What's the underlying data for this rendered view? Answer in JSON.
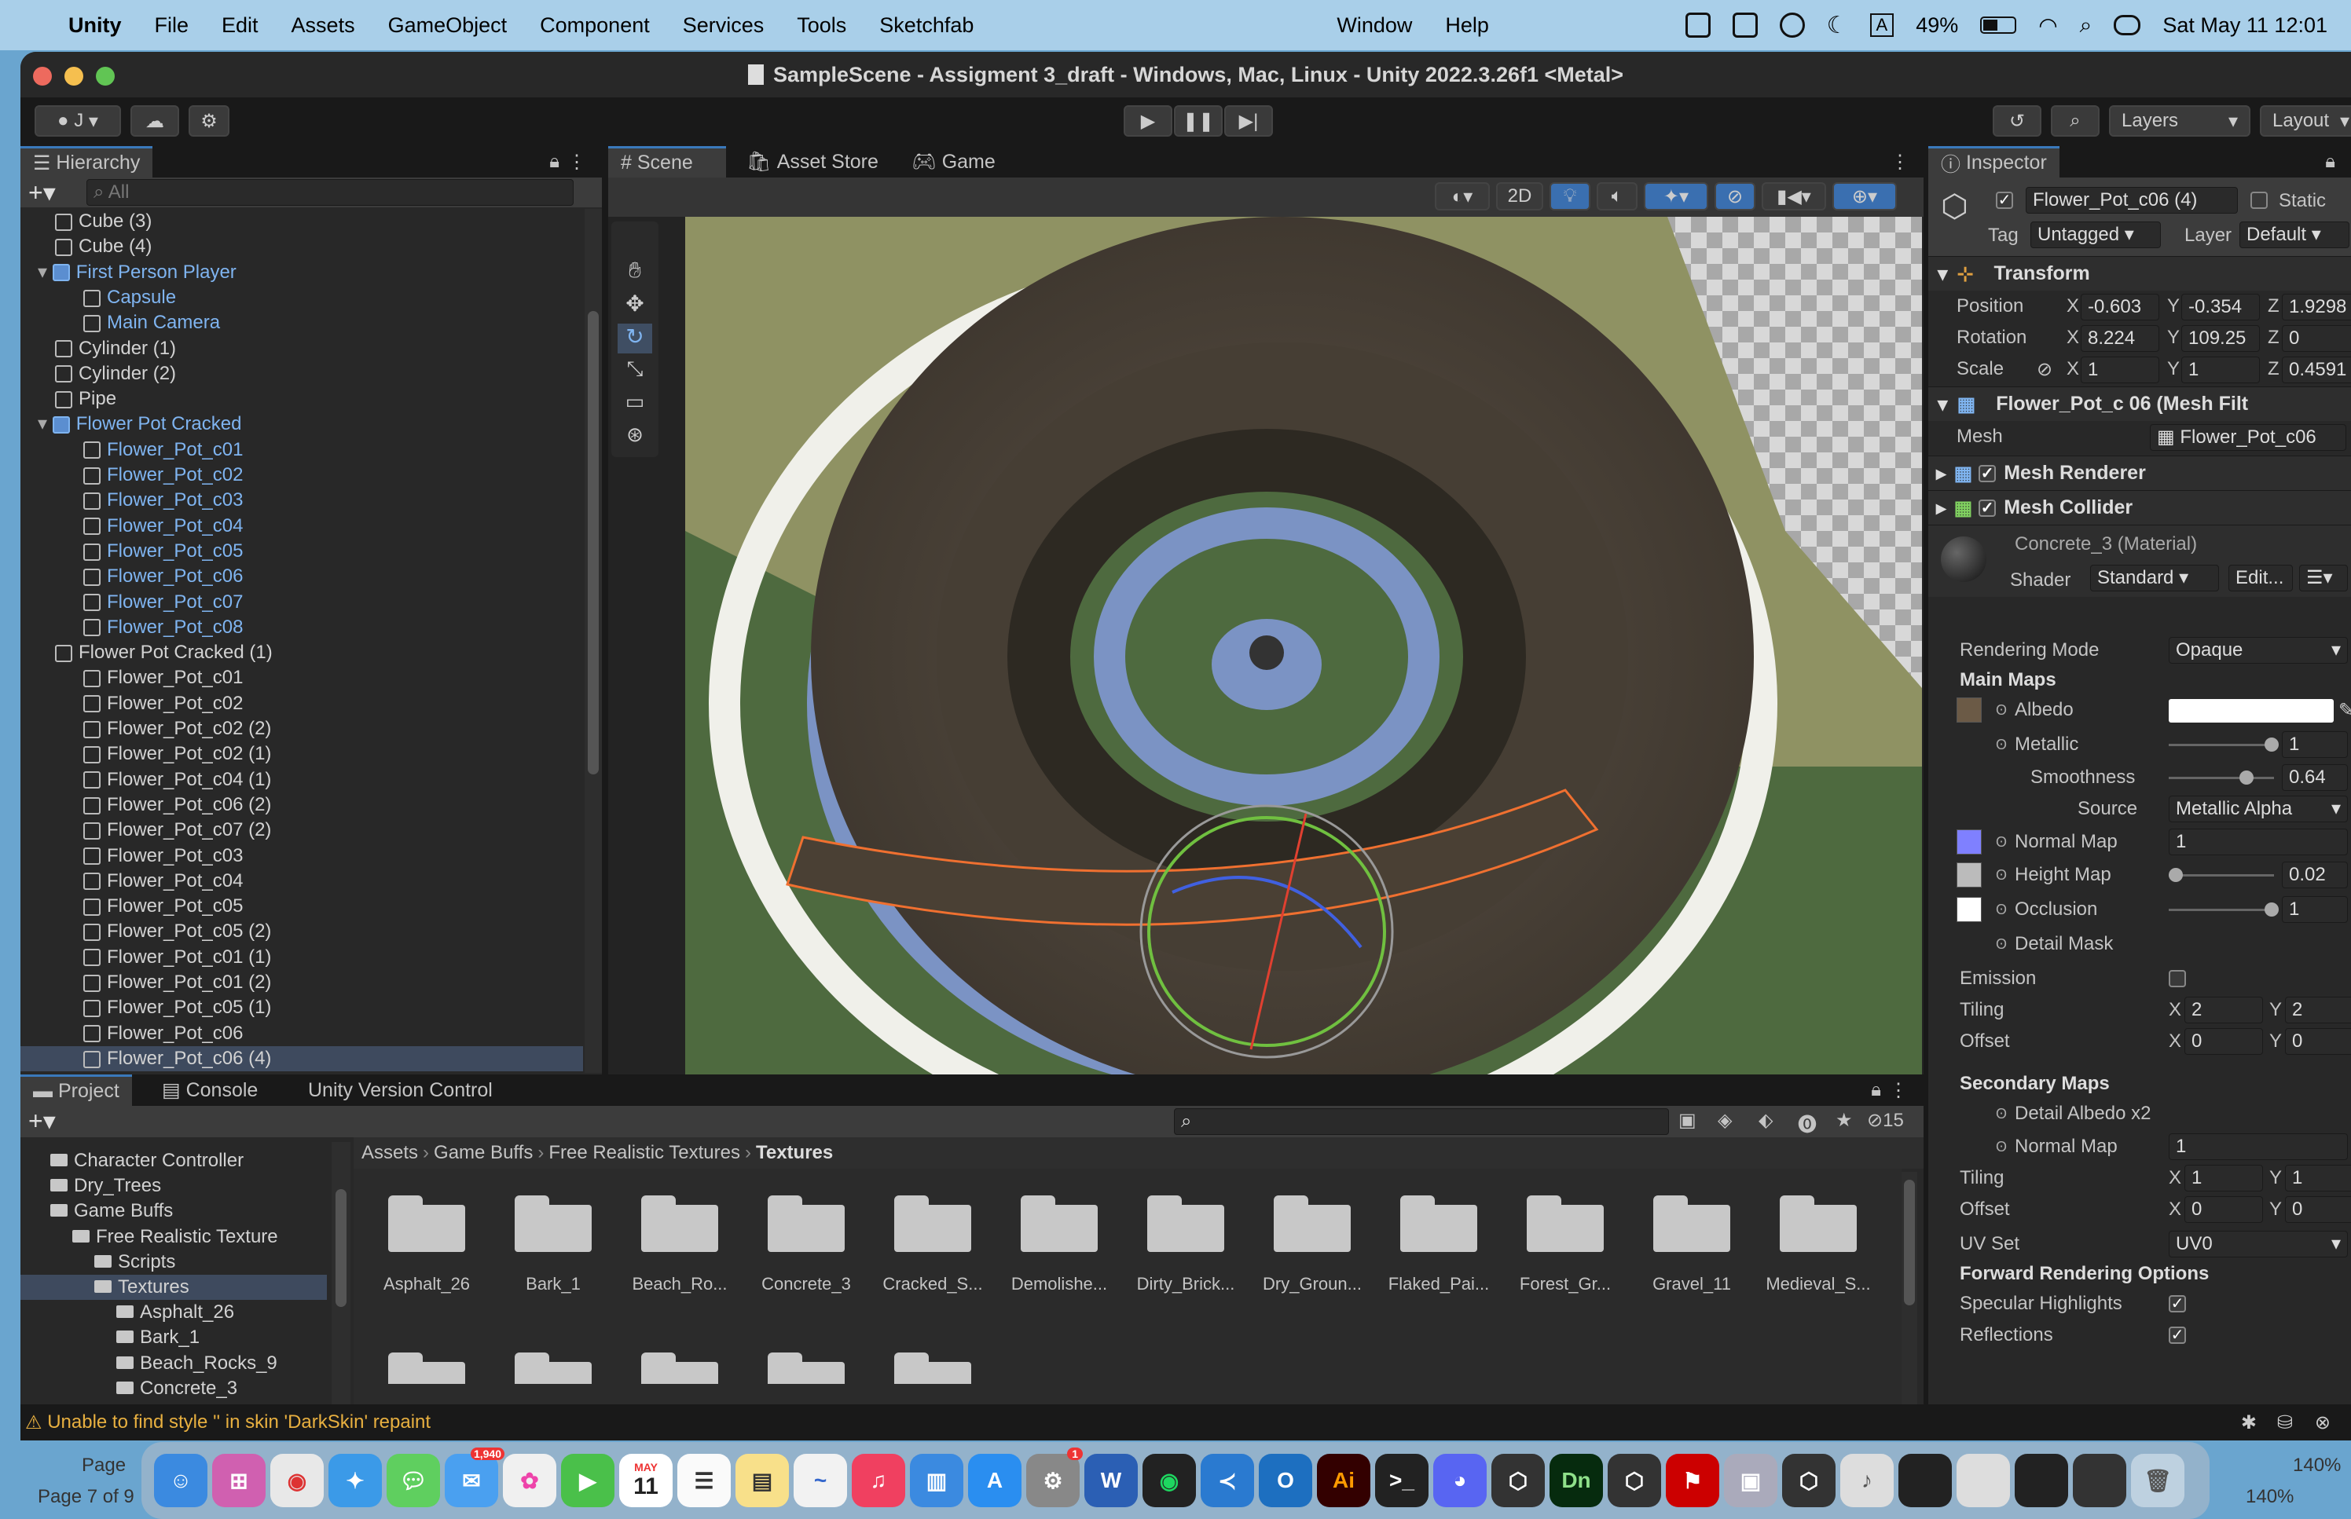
{
  "menubar": {
    "app": "Unity",
    "items": [
      "File",
      "Edit",
      "Assets",
      "GameObject",
      "Component",
      "Services",
      "Tools",
      "Sketchfab",
      "Window",
      "Help"
    ],
    "battery": "49%",
    "input": "A",
    "datetime": "Sat May 11  12:01"
  },
  "window": {
    "title": "SampleScene - Assigment 3_draft - Windows, Mac, Linux - Unity 2022.3.26f1 <Metal>"
  },
  "toolbar": {
    "account": "J",
    "layers": "Layers",
    "layout": "Layout"
  },
  "hierarchy": {
    "tab": "Hierarchy",
    "search_placeholder": "All",
    "items": [
      {
        "label": "Cube (3)",
        "indent": 1,
        "blue": false
      },
      {
        "label": "Cube (4)",
        "indent": 1,
        "blue": false
      },
      {
        "label": "First Person Player",
        "indent": 1,
        "blue": true,
        "prefab": true
      },
      {
        "label": "Capsule",
        "indent": 2,
        "blue": true
      },
      {
        "label": "Main Camera",
        "indent": 2,
        "blue": true
      },
      {
        "label": "Cylinder (1)",
        "indent": 1,
        "blue": false
      },
      {
        "label": "Cylinder (2)",
        "indent": 1,
        "blue": false
      },
      {
        "label": "Pipe",
        "indent": 1,
        "blue": false
      },
      {
        "label": "Flower Pot Cracked",
        "indent": 1,
        "blue": true,
        "prefab": true
      },
      {
        "label": "Flower_Pot_c01",
        "indent": 2,
        "blue": true
      },
      {
        "label": "Flower_Pot_c02",
        "indent": 2,
        "blue": true
      },
      {
        "label": "Flower_Pot_c03",
        "indent": 2,
        "blue": true
      },
      {
        "label": "Flower_Pot_c04",
        "indent": 2,
        "blue": true
      },
      {
        "label": "Flower_Pot_c05",
        "indent": 2,
        "blue": true
      },
      {
        "label": "Flower_Pot_c06",
        "indent": 2,
        "blue": true
      },
      {
        "label": "Flower_Pot_c07",
        "indent": 2,
        "blue": true
      },
      {
        "label": "Flower_Pot_c08",
        "indent": 2,
        "blue": true
      },
      {
        "label": "Flower Pot Cracked (1)",
        "indent": 1,
        "blue": false
      },
      {
        "label": "Flower_Pot_c01",
        "indent": 2,
        "blue": false
      },
      {
        "label": "Flower_Pot_c02",
        "indent": 2,
        "blue": false
      },
      {
        "label": "Flower_Pot_c02 (2)",
        "indent": 2,
        "blue": false
      },
      {
        "label": "Flower_Pot_c02 (1)",
        "indent": 2,
        "blue": false
      },
      {
        "label": "Flower_Pot_c04 (1)",
        "indent": 2,
        "blue": false
      },
      {
        "label": "Flower_Pot_c06 (2)",
        "indent": 2,
        "blue": false
      },
      {
        "label": "Flower_Pot_c07 (2)",
        "indent": 2,
        "blue": false
      },
      {
        "label": "Flower_Pot_c03",
        "indent": 2,
        "blue": false
      },
      {
        "label": "Flower_Pot_c04",
        "indent": 2,
        "blue": false
      },
      {
        "label": "Flower_Pot_c05",
        "indent": 2,
        "blue": false
      },
      {
        "label": "Flower_Pot_c05 (2)",
        "indent": 2,
        "blue": false
      },
      {
        "label": "Flower_Pot_c01 (1)",
        "indent": 2,
        "blue": false
      },
      {
        "label": "Flower_Pot_c01 (2)",
        "indent": 2,
        "blue": false
      },
      {
        "label": "Flower_Pot_c05 (1)",
        "indent": 2,
        "blue": false
      },
      {
        "label": "Flower_Pot_c06",
        "indent": 2,
        "blue": false
      },
      {
        "label": "Flower_Pot_c06 (4)",
        "indent": 2,
        "blue": false,
        "selected": true
      }
    ]
  },
  "scene": {
    "tabs": [
      "Scene",
      "Asset Store",
      "Game"
    ],
    "mode_2d": "2D"
  },
  "project": {
    "tabs": [
      "Project",
      "Console",
      "Unity Version Control"
    ],
    "hidden_count": "15",
    "tree": [
      {
        "label": "Character Controller",
        "indent": 1
      },
      {
        "label": "Dry_Trees",
        "indent": 1
      },
      {
        "label": "Game Buffs",
        "indent": 1
      },
      {
        "label": "Free Realistic Texture",
        "indent": 2
      },
      {
        "label": "Scripts",
        "indent": 3
      },
      {
        "label": "Textures",
        "indent": 3,
        "selected": true
      },
      {
        "label": "Asphalt_26",
        "indent": 4
      },
      {
        "label": "Bark_1",
        "indent": 4
      },
      {
        "label": "Beach_Rocks_9",
        "indent": 4
      },
      {
        "label": "Concrete_3",
        "indent": 4
      }
    ],
    "breadcrumb": [
      "Assets",
      "Game Buffs",
      "Free Realistic Textures",
      "Textures"
    ],
    "folders": [
      "Asphalt_26",
      "Bark_1",
      "Beach_Ro...",
      "Concrete_3",
      "Cracked_S...",
      "Demolishe...",
      "Dirty_Brick...",
      "Dry_Groun...",
      "Flaked_Pai...",
      "Forest_Gr...",
      "Gravel_11",
      "Medieval_S..."
    ]
  },
  "inspector": {
    "tab": "Inspector",
    "object_name": "Flower_Pot_c06 (4)",
    "static": "Static",
    "tag_label": "Tag",
    "tag": "Untagged",
    "layer_label": "Layer",
    "layer": "Default",
    "transform": {
      "title": "Transform",
      "position_label": "Position",
      "position": [
        "-0.603",
        "-0.354",
        "1.9298"
      ],
      "rotation_label": "Rotation",
      "rotation": [
        "8.224",
        "109.25",
        "0"
      ],
      "scale_label": "Scale",
      "scale": [
        "1",
        "1",
        "0.4591"
      ]
    },
    "mesh_filter": {
      "title": "Flower_Pot_c 06 (Mesh Filt",
      "mesh_label": "Mesh",
      "mesh": "Flower_Pot_c06"
    },
    "mesh_renderer": "Mesh Renderer",
    "mesh_collider": "Mesh Collider",
    "material": {
      "name": "Concrete_3 (Material)",
      "shader_label": "Shader",
      "shader": "Standard",
      "edit": "Edit...",
      "rendering_mode_label": "Rendering Mode",
      "rendering_mode": "Opaque",
      "main_maps": "Main Maps",
      "albedo": "Albedo",
      "metallic": "Metallic",
      "metallic_val": "1",
      "smoothness": "Smoothness",
      "smoothness_val": "0.64",
      "source": "Source",
      "source_val": "Metallic Alpha",
      "normal_map": "Normal Map",
      "normal_val": "1",
      "height_map": "Height Map",
      "height_val": "0.02",
      "occlusion": "Occlusion",
      "occlusion_val": "1",
      "detail_mask": "Detail Mask",
      "emission": "Emission",
      "tiling": "Tiling",
      "tiling_val": [
        "2",
        "2"
      ],
      "offset": "Offset",
      "offset_val": [
        "0",
        "0"
      ],
      "secondary_maps": "Secondary Maps",
      "detail_albedo": "Detail Albedo x2",
      "normal_map2": "Normal Map",
      "normal_val2": "1",
      "tiling2_val": [
        "1",
        "1"
      ],
      "offset2_val": [
        "0",
        "0"
      ],
      "uv_set": "UV Set",
      "uv_val": "UV0",
      "forward": "Forward Rendering Options",
      "specular": "Specular Highlights",
      "reflections": "Reflections"
    }
  },
  "statusbar": {
    "warning": "Unable to find style '' in skin 'DarkSkin' repaint"
  },
  "behind": {
    "page": "Page 7 of 9",
    "page2": "Page",
    "zoom": "140%",
    "zoom2": "140%"
  },
  "dock": {
    "mail_badge": "1,940",
    "calendar_month": "MAY",
    "calendar_day": "11",
    "settings_badge": "1"
  }
}
